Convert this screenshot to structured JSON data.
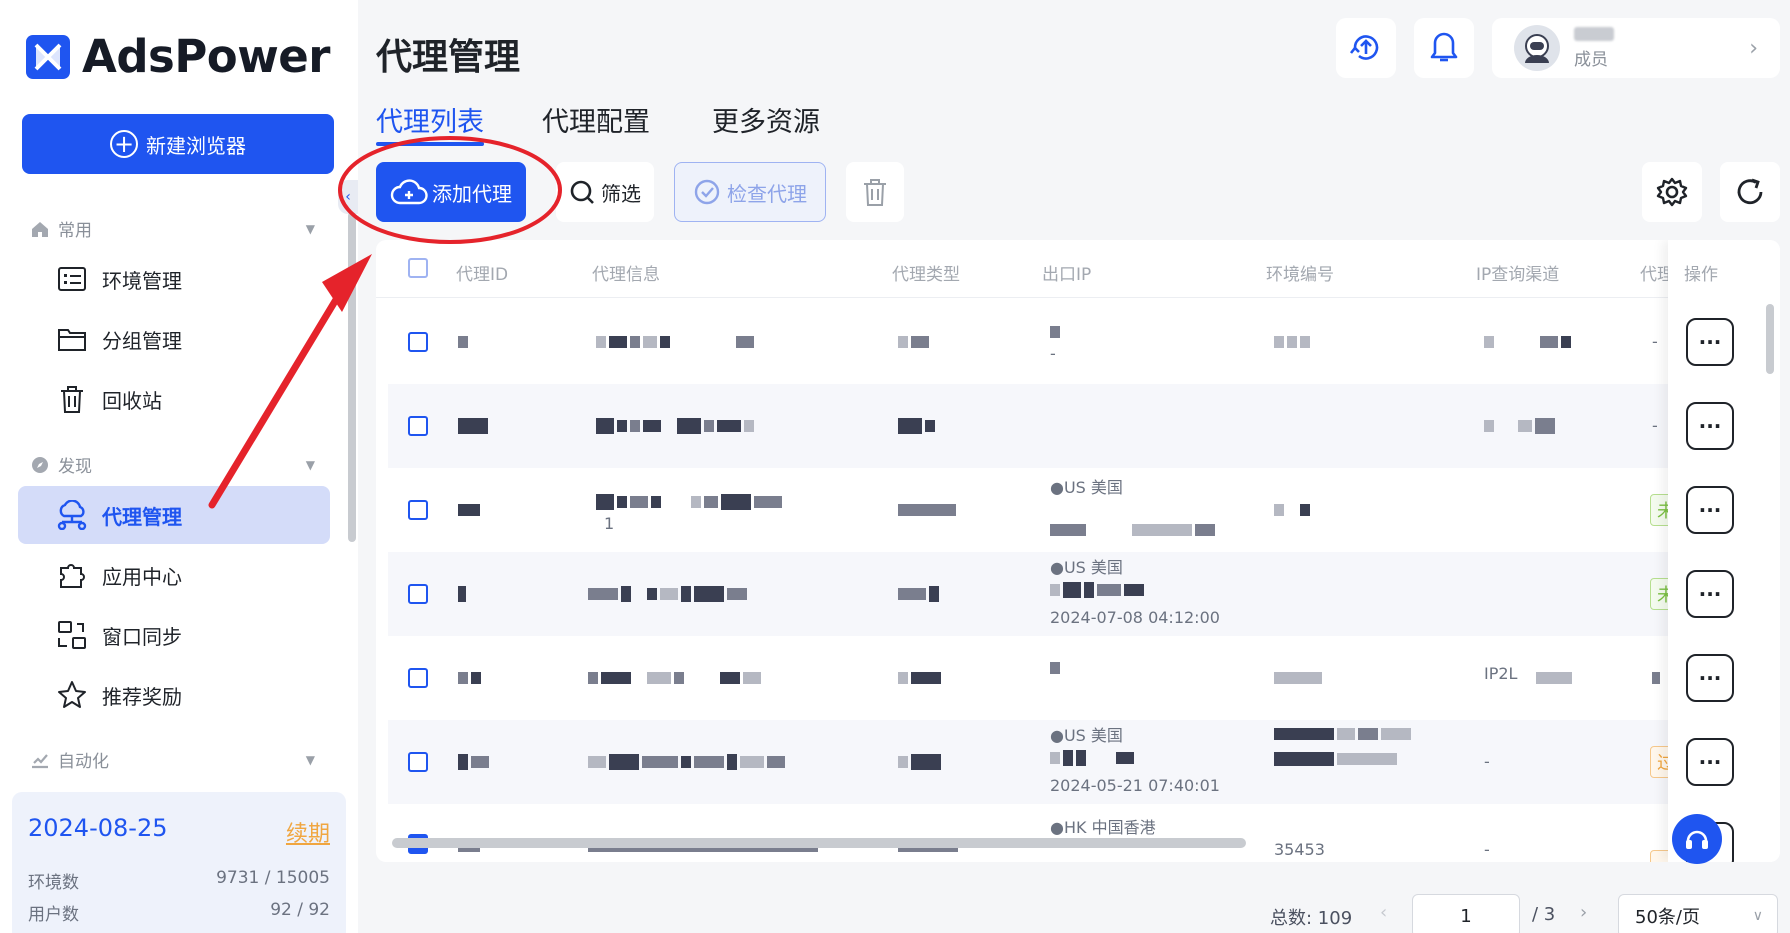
{
  "app": {
    "brand": "AdsPower"
  },
  "sidebar": {
    "new_browser_label": "新建浏览器",
    "sections": [
      {
        "label": "常用",
        "items": [
          "环境管理",
          "分组管理",
          "回收站"
        ]
      },
      {
        "label": "发现",
        "items": [
          "代理管理",
          "应用中心",
          "窗口同步",
          "推荐奖励"
        ]
      },
      {
        "label": "自动化",
        "items": []
      }
    ],
    "active_item": "代理管理",
    "plan": {
      "date": "2024-08-25",
      "renew_label": "续期",
      "env_label": "环境数",
      "env_value": "9731 / 15005",
      "user_label": "用户数",
      "user_value": "92 / 92"
    }
  },
  "header": {
    "title": "代理管理",
    "user_role": "成员"
  },
  "tabs": [
    "代理列表",
    "代理配置",
    "更多资源"
  ],
  "active_tab": "代理列表",
  "toolbar": {
    "add_proxy": "添加代理",
    "filter": "筛选",
    "check_proxy": "检查代理"
  },
  "table": {
    "columns": [
      "代理ID",
      "代理信息",
      "代理类型",
      "出口IP",
      "环境编号",
      "IP查询渠道",
      "代理",
      "操作"
    ],
    "rows": [
      {
        "exit_ip_lines": [
          "",
          "-"
        ],
        "channel": "",
        "status": "-"
      },
      {
        "exit_ip_lines": [],
        "channel": "",
        "status": "-"
      },
      {
        "proxy_info_line2": "1",
        "exit_ip_lines": [
          "●US 美国"
        ],
        "status_tag": "未"
      },
      {
        "exit_ip_lines": [
          "●US 美国",
          "2024-07-08 04:12:00"
        ],
        "status_tag": "未"
      },
      {
        "exit_ip_lines": [],
        "channel": "IP2L",
        "status": ""
      },
      {
        "exit_ip_lines": [
          "●US 美国",
          "2024-05-21 07:40:01"
        ],
        "channel": "-",
        "status_tag": "过"
      },
      {
        "exit_ip_lines": [
          "●HK 中国香港"
        ],
        "env_no": "35453",
        "channel": "-",
        "status_tag": ""
      }
    ]
  },
  "pagination": {
    "total_label": "总数: 109",
    "current_page": "1",
    "total_pages": "/ 3",
    "page_size": "50条/页"
  },
  "colors": {
    "accent": "#1f55f0",
    "annotation": "#e5232b"
  }
}
